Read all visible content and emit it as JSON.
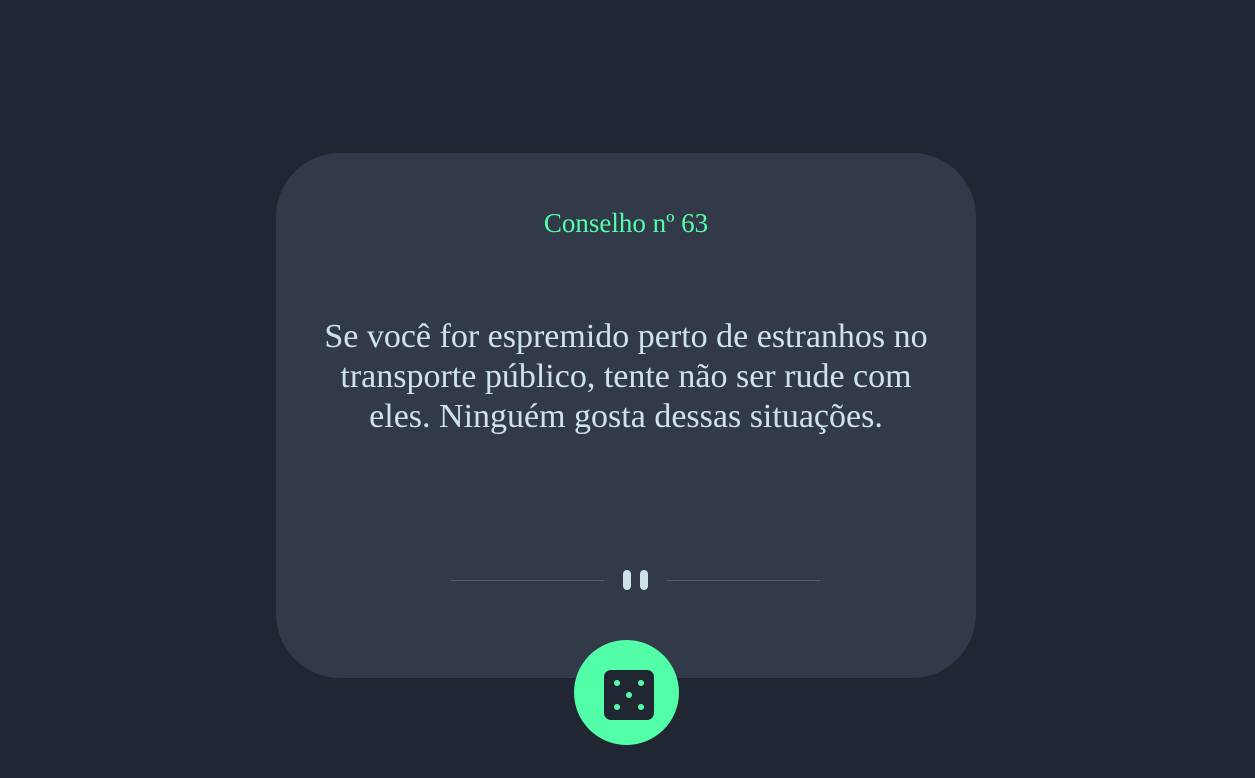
{
  "card": {
    "advice_id_label": "Conselho nº 63",
    "advice_text": "Se você for espremido perto de estranhos no transporte público, tente não ser rude com eles. Ninguém gosta dessas situações."
  },
  "icons": {
    "divider": "pause-icon",
    "button": "dice-icon"
  },
  "colors": {
    "background": "#202632",
    "card": "#323a4a",
    "accent": "#52ffa8",
    "text": "#cee3e9",
    "divider_line": "#4f5b6b"
  }
}
